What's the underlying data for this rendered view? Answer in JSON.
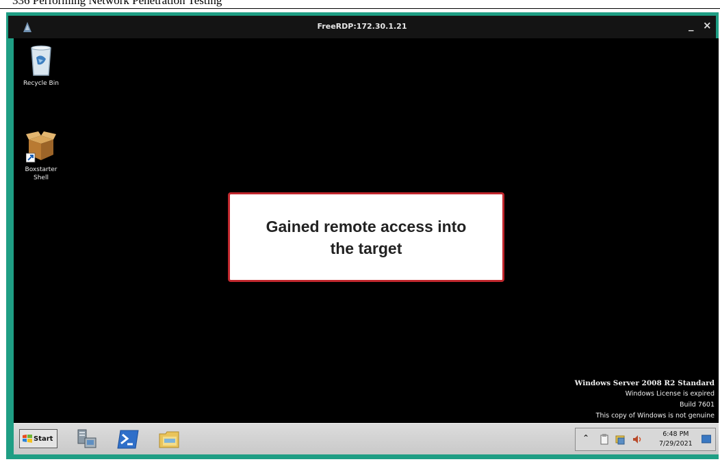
{
  "page_header": {
    "text": "336    Performing Network Penetration Testing"
  },
  "window": {
    "title": "FreeRDP:172.30.1.21",
    "minimize_label": "_",
    "close_label": "×",
    "app_icon": "freerdp-icon"
  },
  "desktop": {
    "icons": [
      {
        "label": "Recycle Bin",
        "icon": "recycle-bin-icon"
      },
      {
        "label": "Boxstarter Shell",
        "icon": "package-box-icon"
      }
    ],
    "callout": "Gained remote access into the target",
    "watermark": {
      "line1": "Windows Server 2008 R2 Standard",
      "line2": "Windows License is expired",
      "line3": "Build 7601",
      "line4": "This copy of Windows is not genuine"
    }
  },
  "taskbar": {
    "start_label": "Start",
    "pinned": [
      {
        "icon": "server-manager-icon"
      },
      {
        "icon": "powershell-icon"
      },
      {
        "icon": "file-explorer-icon"
      }
    ],
    "tray": {
      "expand_label": "⌃",
      "time": "6:48 PM",
      "date": "7/29/2021"
    }
  },
  "colors": {
    "frame": "#1f9e84",
    "titlebar": "#141414",
    "desktop": "#000000",
    "callout_border": "#c0272d",
    "taskbar": "#d2d2d2"
  }
}
